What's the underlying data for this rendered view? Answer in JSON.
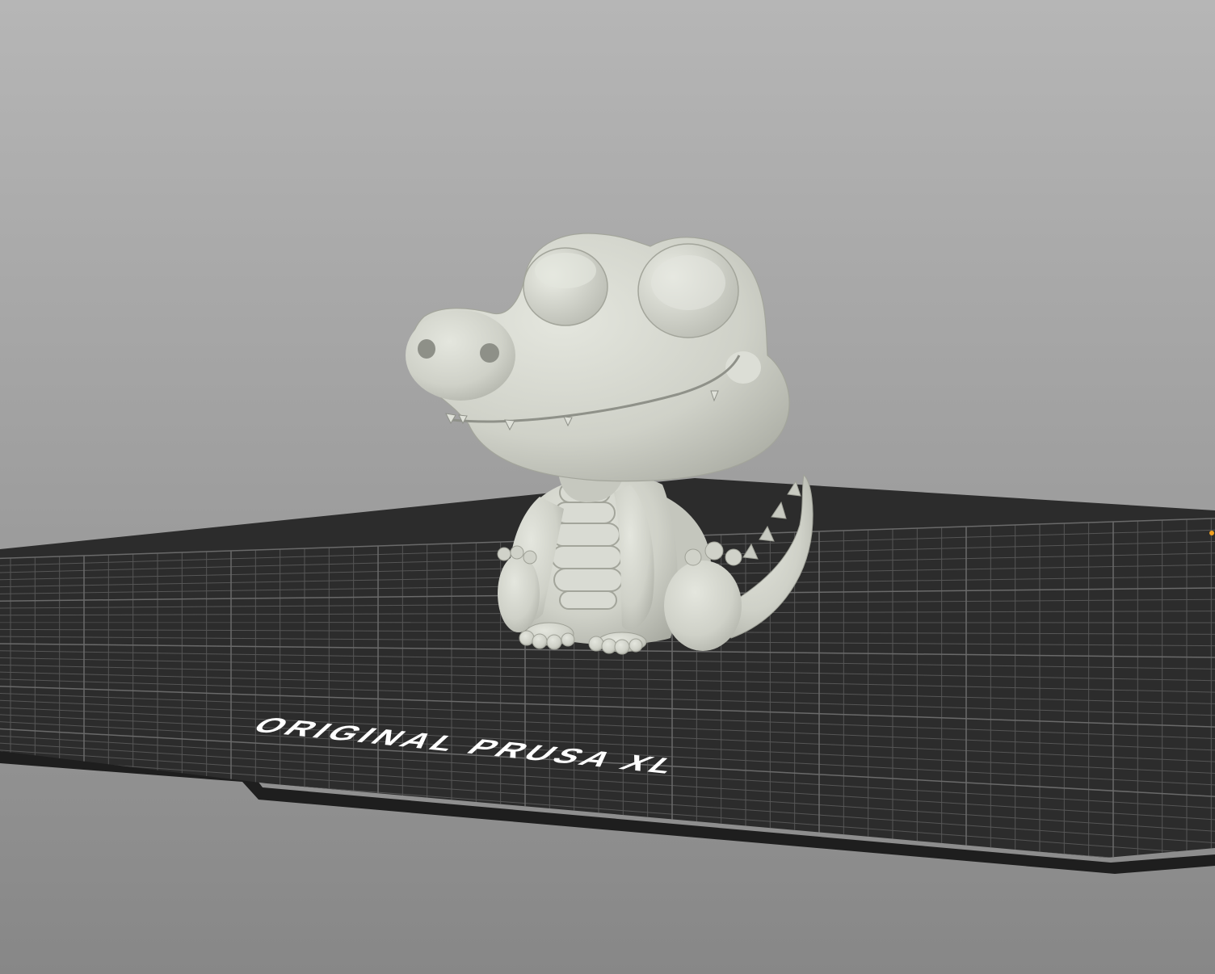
{
  "app": {
    "view": "3D plater viewport"
  },
  "bed": {
    "label": "ORIGINAL PRUSA XL",
    "surface_color": "#2b2b2b",
    "grid_color": "#5a5a5a",
    "label_color": "#ffffff"
  },
  "model": {
    "name": "crocodile",
    "color": "#d6d8d0"
  },
  "background": {
    "top_color": "#b4b4b4",
    "bottom_color": "#8a8a8a"
  },
  "icons": {
    "origin_marker": "axis-origin-icon"
  },
  "colors": {
    "origin_marker": "#f0a020"
  }
}
